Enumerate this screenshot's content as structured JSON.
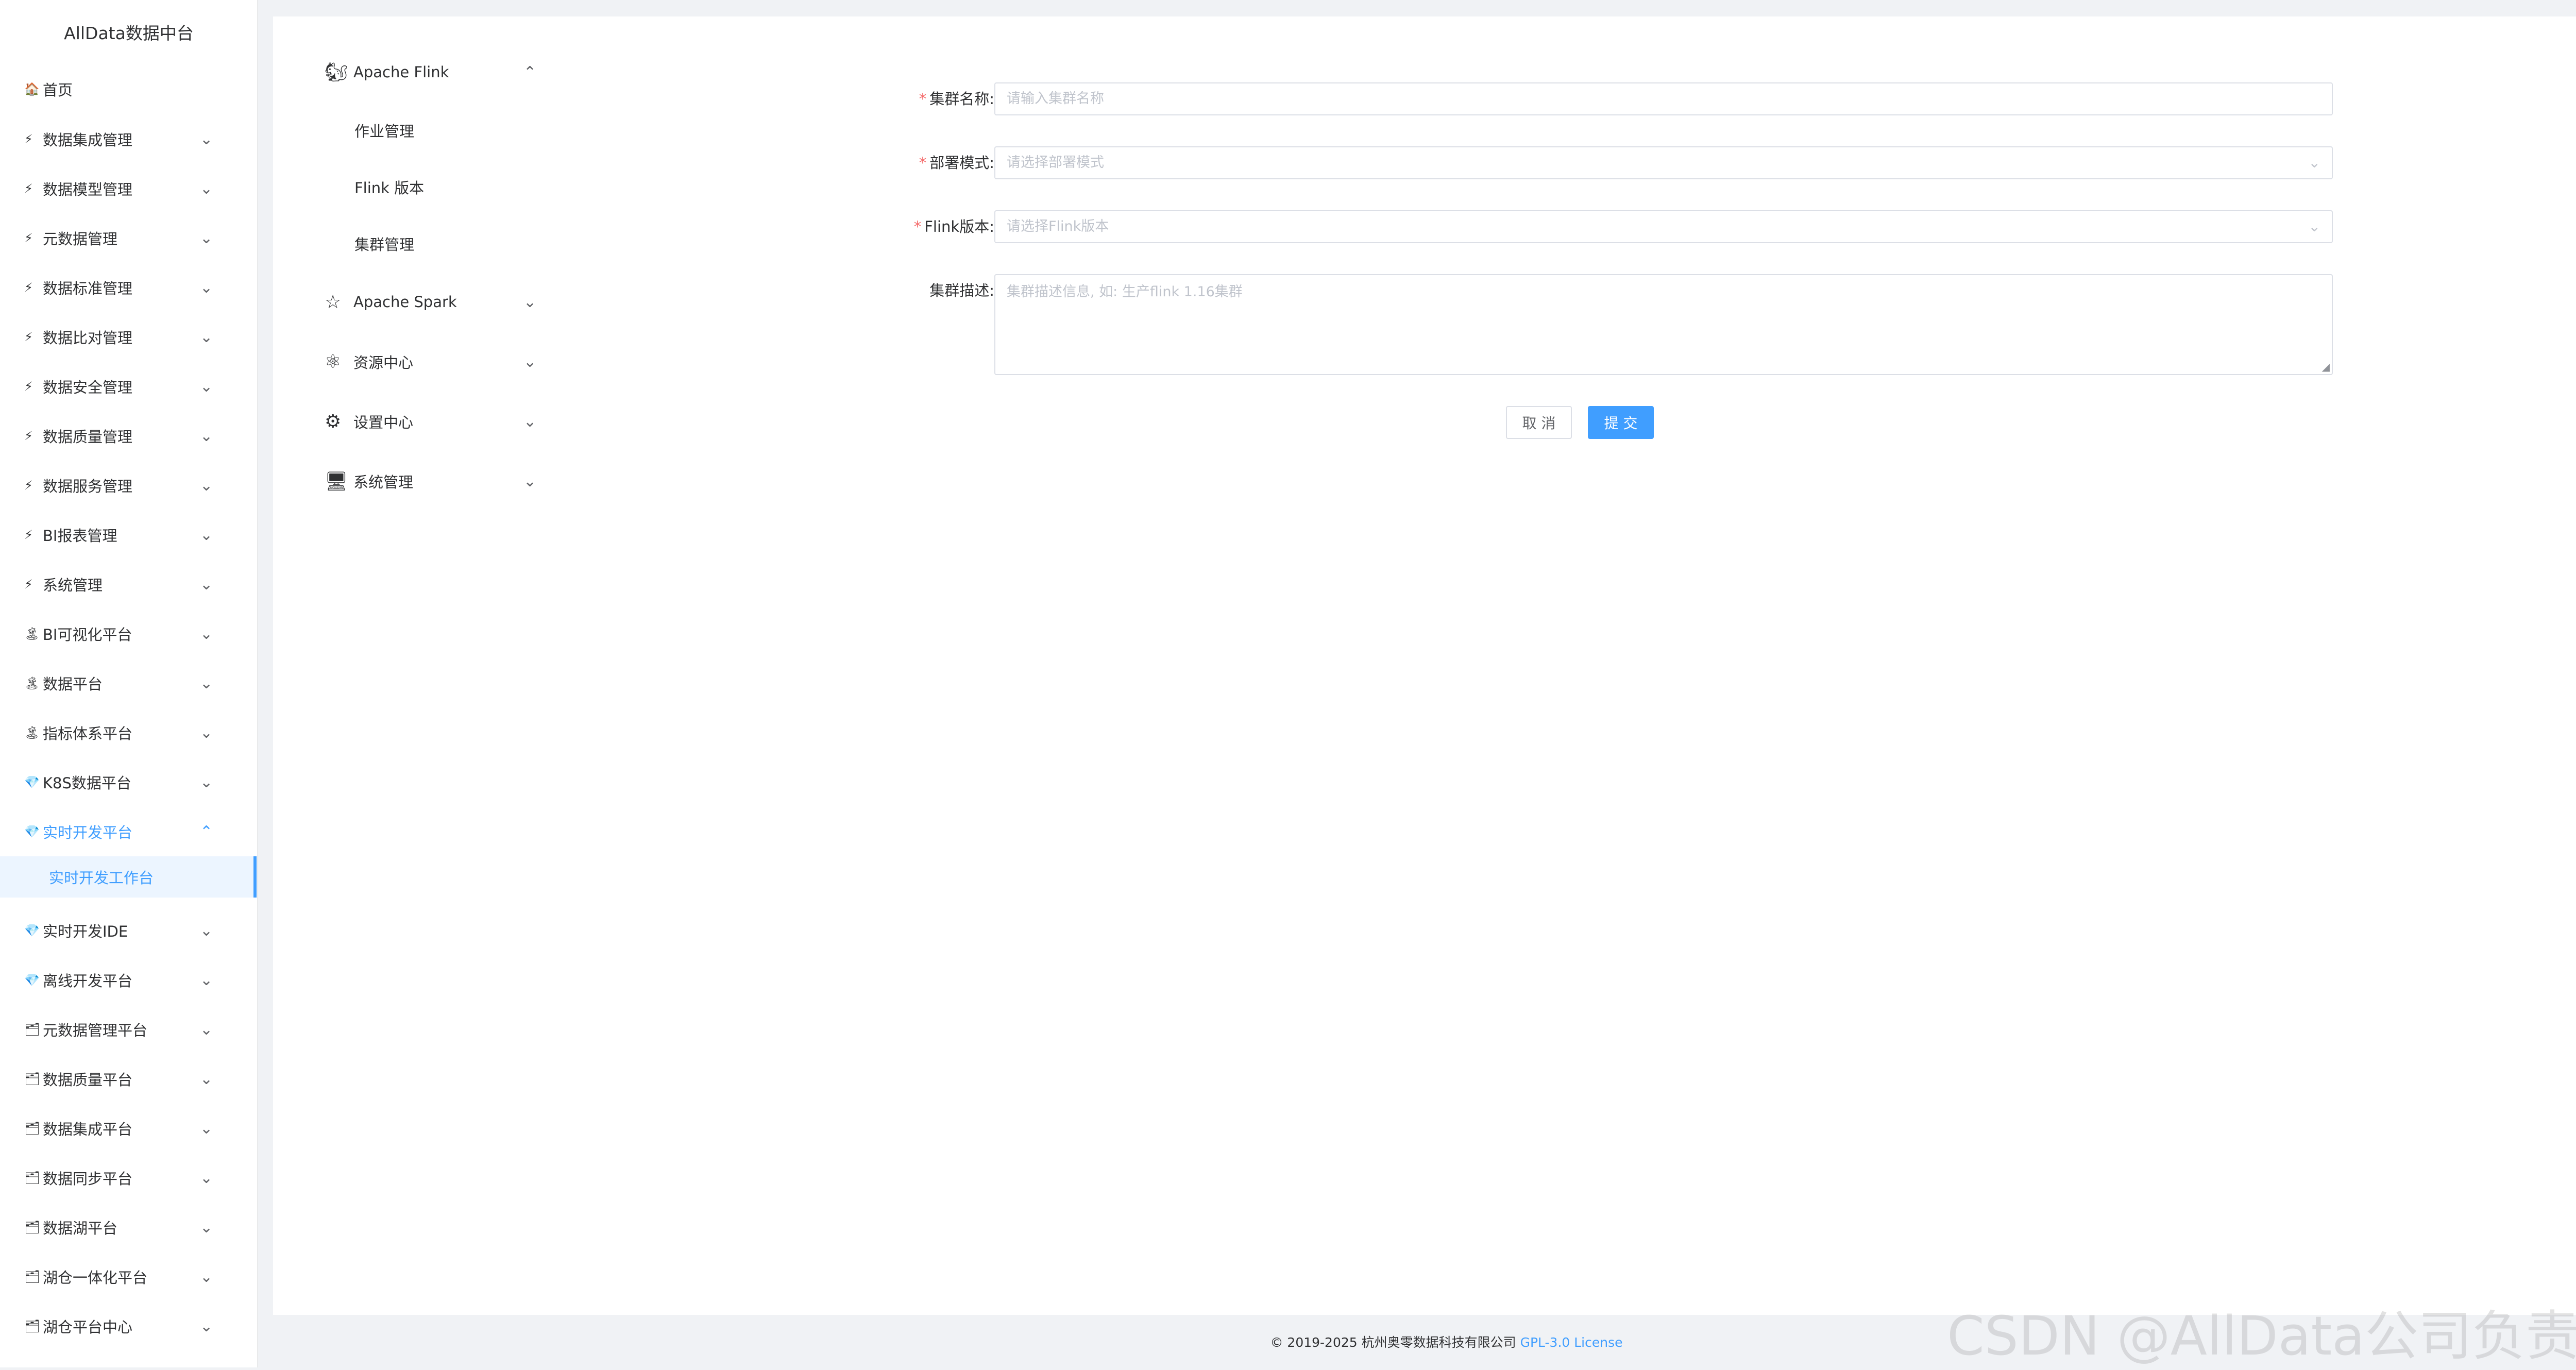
{
  "app": {
    "title": "AllData数据中台"
  },
  "sidebar": {
    "home": {
      "label": "首页",
      "icon": "house-icon"
    },
    "items": [
      {
        "label": "数据集成管理",
        "icon": "bolt-icon"
      },
      {
        "label": "数据模型管理",
        "icon": "bolt-icon"
      },
      {
        "label": "元数据管理",
        "icon": "bolt-icon"
      },
      {
        "label": "数据标准管理",
        "icon": "bolt-icon"
      },
      {
        "label": "数据比对管理",
        "icon": "bolt-icon"
      },
      {
        "label": "数据安全管理",
        "icon": "bolt-icon"
      },
      {
        "label": "数据质量管理",
        "icon": "bolt-icon"
      },
      {
        "label": "数据服务管理",
        "icon": "bolt-icon"
      },
      {
        "label": "BI报表管理",
        "icon": "bolt-icon"
      },
      {
        "label": "系统管理",
        "icon": "bolt-icon"
      },
      {
        "label": "BI可视化平台",
        "icon": "tree-icon"
      },
      {
        "label": "数据平台",
        "icon": "tree-icon"
      },
      {
        "label": "指标体系平台",
        "icon": "tree-icon"
      },
      {
        "label": "K8S数据平台",
        "icon": "gem-icon"
      },
      {
        "label": "实时开发平台",
        "icon": "gem-icon"
      },
      {
        "label": "实时开发IDE",
        "icon": "gem-icon"
      },
      {
        "label": "离线开发平台",
        "icon": "gem-icon"
      },
      {
        "label": "元数据管理平台",
        "icon": "stack-icon"
      },
      {
        "label": "数据质量平台",
        "icon": "stack-icon"
      },
      {
        "label": "数据集成平台",
        "icon": "stack-icon"
      },
      {
        "label": "数据同步平台",
        "icon": "stack-icon"
      },
      {
        "label": "数据湖平台",
        "icon": "stack-icon"
      },
      {
        "label": "湖仓一体化平台",
        "icon": "stack-icon"
      },
      {
        "label": "湖仓平台中心",
        "icon": "stack-icon"
      }
    ],
    "active_sub": "实时开发工作台",
    "accent": "#409eff"
  },
  "menu": {
    "flink": {
      "label": "Apache Flink",
      "children": [
        "作业管理",
        "Flink 版本",
        "集群管理"
      ]
    },
    "spark": {
      "label": "Apache Spark"
    },
    "resource": {
      "label": "资源中心"
    },
    "settings": {
      "label": "设置中心"
    },
    "system": {
      "label": "系统管理"
    }
  },
  "form": {
    "cluster_name": {
      "label": "集群名称:",
      "placeholder": "请输入集群名称"
    },
    "deploy_mode": {
      "label": "部署模式:",
      "placeholder": "请选择部署模式"
    },
    "flink_version": {
      "label": "Flink版本:",
      "placeholder": "请选择Flink版本"
    },
    "description": {
      "label": "集群描述:",
      "placeholder": "集群描述信息, 如: 生产flink 1.16集群"
    },
    "cancel": "取 消",
    "submit": "提 交"
  },
  "footer": {
    "copyright": "© 2019-2025 杭州奥零数据科技有限公司",
    "license": "GPL-3.0 License"
  },
  "watermark": "CSDN @AllData公司负责人"
}
